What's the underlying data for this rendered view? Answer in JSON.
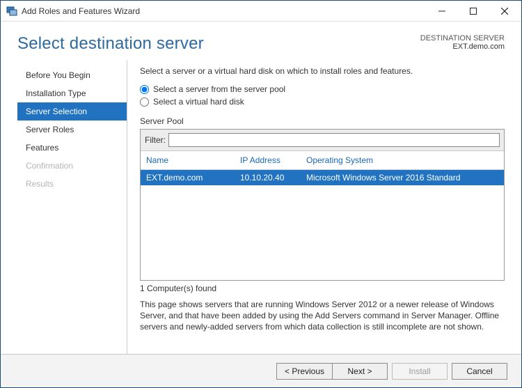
{
  "window": {
    "title": "Add Roles and Features Wizard"
  },
  "header": {
    "page_title": "Select destination server",
    "dest_label": "DESTINATION SERVER",
    "dest_server": "EXT.demo.com"
  },
  "sidebar": {
    "steps": [
      {
        "label": "Before You Begin",
        "state": "normal"
      },
      {
        "label": "Installation Type",
        "state": "normal"
      },
      {
        "label": "Server Selection",
        "state": "active"
      },
      {
        "label": "Server Roles",
        "state": "normal"
      },
      {
        "label": "Features",
        "state": "normal"
      },
      {
        "label": "Confirmation",
        "state": "disabled"
      },
      {
        "label": "Results",
        "state": "disabled"
      }
    ]
  },
  "content": {
    "instruction": "Select a server or a virtual hard disk on which to install roles and features.",
    "radio_pool": "Select a server from the server pool",
    "radio_vhd": "Select a virtual hard disk",
    "pool_heading": "Server Pool",
    "filter_label": "Filter:",
    "filter_value": "",
    "columns": {
      "name": "Name",
      "ip": "IP Address",
      "os": "Operating System"
    },
    "rows": [
      {
        "name": "EXT.demo.com",
        "ip": "10.10.20.40",
        "os": "Microsoft Windows Server 2016 Standard"
      }
    ],
    "found_text": "1 Computer(s) found",
    "note": "This page shows servers that are running Windows Server 2012 or a newer release of Windows Server, and that have been added by using the Add Servers command in Server Manager. Offline servers and newly-added servers from which data collection is still incomplete are not shown."
  },
  "footer": {
    "previous": "< Previous",
    "next": "Next >",
    "install": "Install",
    "cancel": "Cancel"
  }
}
